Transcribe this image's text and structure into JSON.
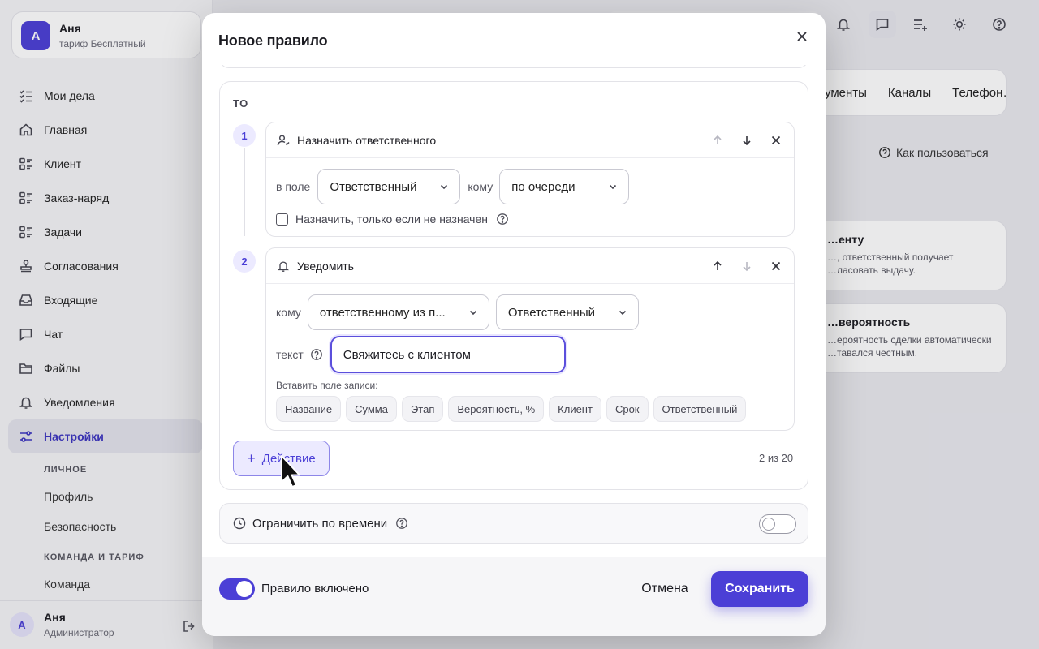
{
  "sidebar": {
    "user": {
      "initial": "А",
      "name": "Аня",
      "plan": "тариф Бесплатный"
    },
    "items": [
      {
        "label": "Мои дела",
        "icon": "checklist-icon"
      },
      {
        "label": "Главная",
        "icon": "home-icon"
      },
      {
        "label": "Клиент",
        "icon": "list-icon"
      },
      {
        "label": "Заказ-наряд",
        "icon": "list-icon"
      },
      {
        "label": "Задачи",
        "icon": "list-icon"
      },
      {
        "label": "Согласования",
        "icon": "stamp-icon"
      },
      {
        "label": "Входящие",
        "icon": "inbox-icon"
      },
      {
        "label": "Чат",
        "icon": "chat-icon"
      },
      {
        "label": "Файлы",
        "icon": "folder-icon"
      },
      {
        "label": "Уведомления",
        "icon": "bell-icon"
      },
      {
        "label": "Настройки",
        "icon": "sliders-icon",
        "active": true
      }
    ],
    "section_personal": "ЛИЧНОЕ",
    "personal": [
      "Профиль",
      "Безопасность"
    ],
    "section_team": "КОМАНДА И ТАРИФ",
    "team": [
      "Команда"
    ],
    "footer": {
      "initial": "А",
      "name": "Аня",
      "role": "Администратор"
    }
  },
  "background": {
    "tabs": [
      "…ументы",
      "Каналы",
      "Телефон…"
    ],
    "howto": "Как пользоваться",
    "cards": [
      {
        "title": "…енту",
        "desc1": "…, ответственный получает",
        "desc2": "…ласовать выдачу."
      },
      {
        "title": "…вероятность",
        "desc1": "…ероятность сделки автоматически",
        "desc2": "…тавался честным."
      }
    ]
  },
  "modal": {
    "title": "Новое правило",
    "then_label": "ТО",
    "actions": [
      {
        "num": "1",
        "title": "Назначить ответственного",
        "field_label": "в поле",
        "field_value": "Ответственный",
        "to_label": "кому",
        "to_value": "по очереди",
        "checkbox_label": "Назначить, только если не назначен"
      },
      {
        "num": "2",
        "title": "Уведомить",
        "to_label": "кому",
        "to_value": "ответственному из п...",
        "field_value": "Ответственный",
        "text_label": "текст",
        "text_value": "Свяжитесь с клиентом",
        "insert_label": "Вставить поле записи:",
        "chips": [
          "Название",
          "Сумма",
          "Этап",
          "Вероятность, %",
          "Клиент",
          "Срок",
          "Ответственный"
        ]
      }
    ],
    "add_action": "Действие",
    "counter": "2 из 20",
    "time_limit": {
      "label": "Ограничить по времени",
      "enabled": false
    },
    "footer": {
      "rule_enabled_label": "Правило включено",
      "rule_enabled": true,
      "cancel": "Отмена",
      "save": "Сохранить"
    }
  },
  "colors": {
    "accent": "#4b3fd6",
    "accent_soft": "#eceaff"
  }
}
